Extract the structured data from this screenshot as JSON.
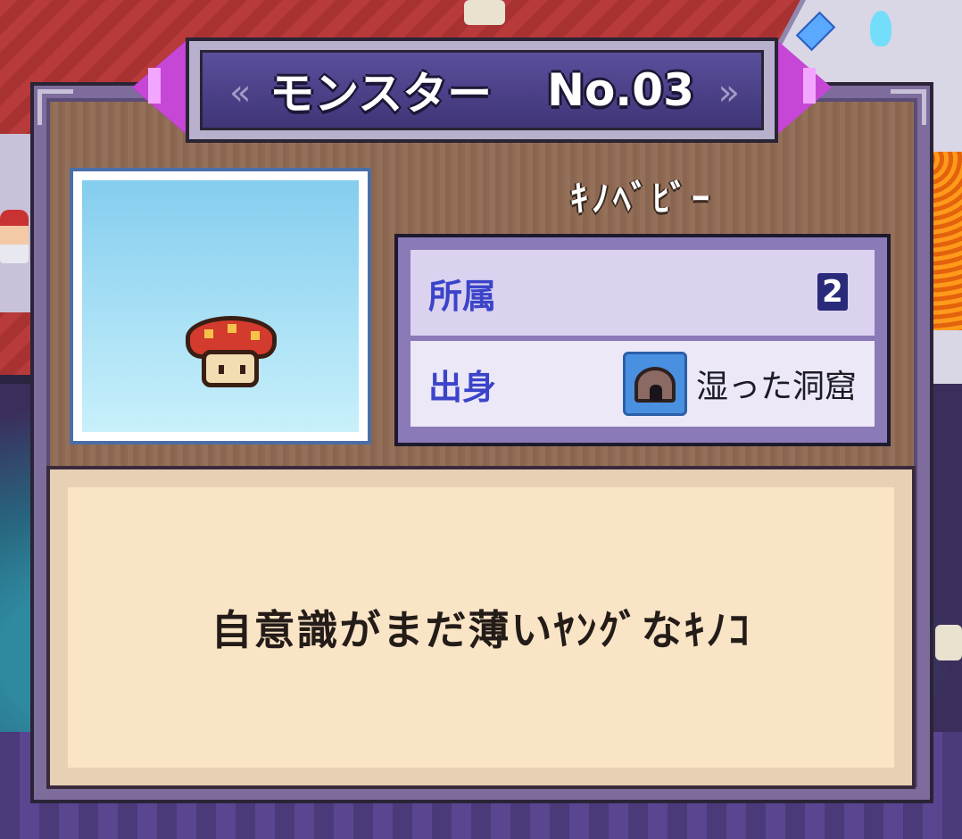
{
  "banner": {
    "label": "モンスター",
    "number": "No.03",
    "prev_icon": "arrow-left",
    "next_icon": "arrow-right"
  },
  "monster": {
    "name": "ｷﾉﾍﾞﾋﾞｰ",
    "portrait_icon": "mushroom-monster"
  },
  "info": {
    "affiliation_label": "所属",
    "affiliation_value": "2",
    "origin_label": "出身",
    "origin_icon": "cave-icon",
    "origin_value": "湿った洞窟"
  },
  "description": "自意識がまだ薄いﾔﾝｸﾞなｷﾉｺ",
  "colors": {
    "title_bar": "#4a3f8c",
    "arrow": "#c646d6",
    "label_blue": "#3b44c9",
    "desc_bg": "#fae4c6"
  }
}
